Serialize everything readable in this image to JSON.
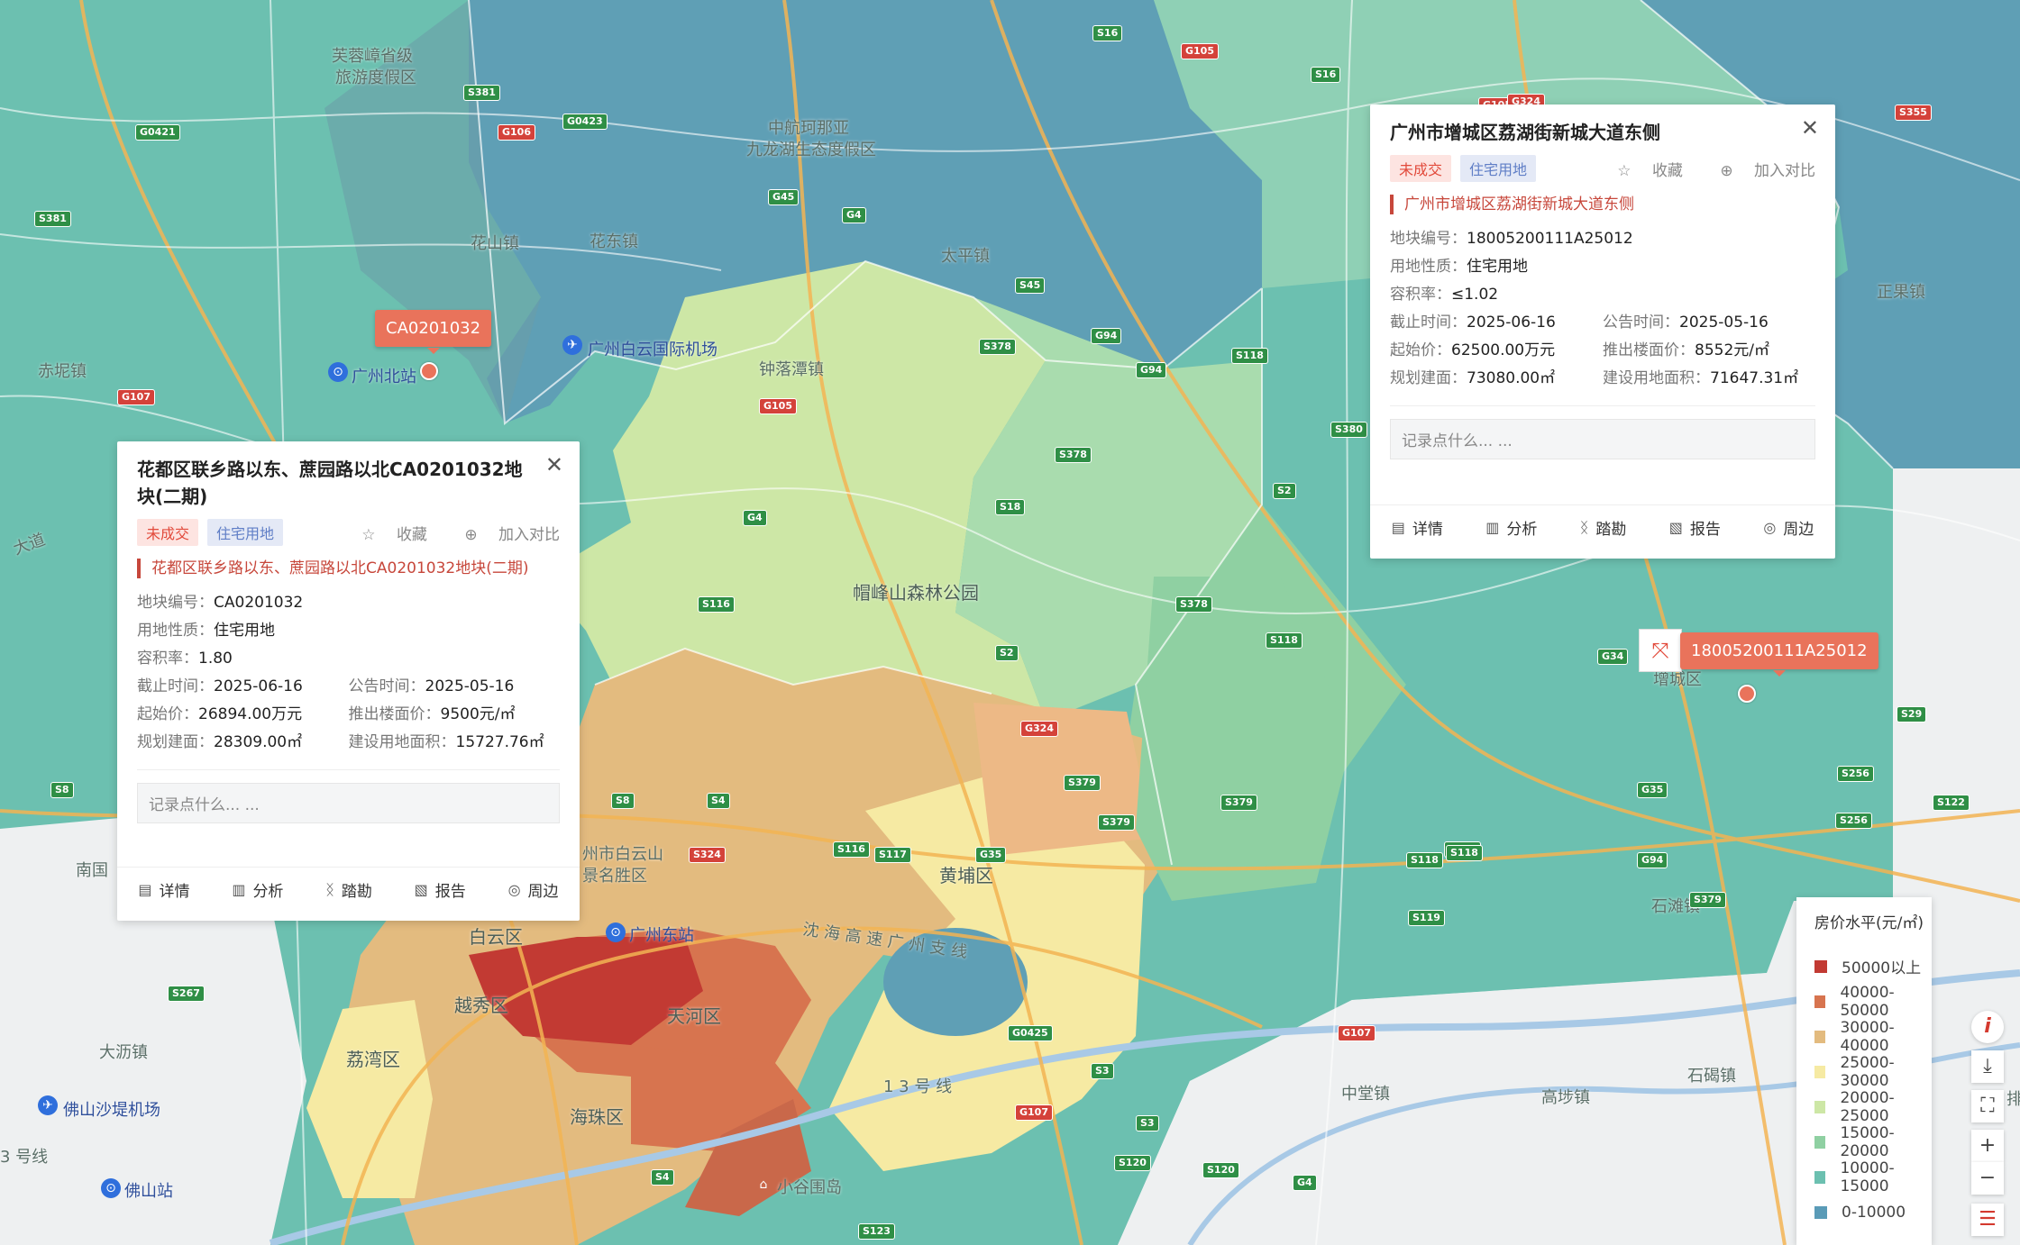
{
  "map": {
    "place_labels": [
      {
        "text": "芙蓉嶂省级",
        "name": "place-furongzhang"
      },
      {
        "text": "旅游度假区",
        "name": "place-resort"
      },
      {
        "text": "中航珂那亚",
        "name": "place-zhonghang"
      },
      {
        "text": "九龙湖生态度假区",
        "name": "place-jiulonghu"
      },
      {
        "text": "花山镇",
        "name": "place-huashan"
      },
      {
        "text": "花东镇",
        "name": "place-huadong"
      },
      {
        "text": "太平镇",
        "name": "place-taiping"
      },
      {
        "text": "钟落潭镇",
        "name": "place-zhongluotan"
      },
      {
        "text": "赤坭镇",
        "name": "place-chini"
      },
      {
        "text": "帽峰山森林公园",
        "name": "place-maofengshan"
      },
      {
        "text": "正果镇",
        "name": "place-zhengguo"
      },
      {
        "text": "黄埔区",
        "name": "place-huangpu"
      },
      {
        "text": "白云区",
        "name": "place-baiyun"
      },
      {
        "text": "越秀区",
        "name": "place-yuexiu"
      },
      {
        "text": "天河区",
        "name": "place-tianhe"
      },
      {
        "text": "荔湾区",
        "name": "place-liwan"
      },
      {
        "text": "海珠区",
        "name": "place-haizhu"
      },
      {
        "text": "大沥镇",
        "name": "place-dali"
      },
      {
        "text": "南国",
        "name": "place-nanguo"
      },
      {
        "text": "中堂镇",
        "name": "place-zhongtang"
      },
      {
        "text": "高埗镇",
        "name": "place-gaobu"
      },
      {
        "text": "石碣镇",
        "name": "place-shijie"
      },
      {
        "text": "石滩镇",
        "name": "place-shitan"
      },
      {
        "text": "1 3 号 线",
        "name": "place-line13"
      },
      {
        "text": "沈 海 高 速 广 州 支 线",
        "name": "place-shenhai"
      },
      {
        "text": "州市白云山",
        "name": "place-baiyunshan1"
      },
      {
        "text": "景名胜区",
        "name": "place-baiyunshan2"
      },
      {
        "text": "增城区",
        "name": "place-zengcheng"
      },
      {
        "text": "大道",
        "name": "place-dadao"
      },
      {
        "text": "排",
        "name": "place-pai"
      },
      {
        "text": "3 号线",
        "name": "place-line3"
      }
    ],
    "poi_labels": [
      {
        "text": "广州白云国际机场",
        "name": "poi-baiyun-airport"
      },
      {
        "text": "广州北站",
        "name": "poi-guangzhou-north"
      },
      {
        "text": "广州东站",
        "name": "poi-guangzhou-east"
      },
      {
        "text": "佛山沙堤机场",
        "name": "poi-shadi-airport"
      },
      {
        "text": "佛山站",
        "name": "poi-foshan-station"
      },
      {
        "text": "小谷围岛",
        "name": "poi-xiaoguwei"
      }
    ],
    "shields": [
      {
        "text": "S381",
        "t": "s"
      },
      {
        "text": "G106",
        "t": "g"
      },
      {
        "text": "G0423",
        "t": "s"
      },
      {
        "text": "G0421",
        "t": "s"
      },
      {
        "text": "S381",
        "t": "s"
      },
      {
        "text": "G45",
        "t": "s"
      },
      {
        "text": "G4",
        "t": "s"
      },
      {
        "text": "S16",
        "t": "s"
      },
      {
        "text": "G105",
        "t": "g"
      },
      {
        "text": "S16",
        "t": "s"
      },
      {
        "text": "S45",
        "t": "s"
      },
      {
        "text": "G105",
        "t": "g"
      },
      {
        "text": "G94",
        "t": "s"
      },
      {
        "text": "S378",
        "t": "s"
      },
      {
        "text": "G94",
        "t": "s"
      },
      {
        "text": "S118",
        "t": "s"
      },
      {
        "text": "G107",
        "t": "g"
      },
      {
        "text": "G105",
        "t": "g"
      },
      {
        "text": "S378",
        "t": "s"
      },
      {
        "text": "S380",
        "t": "s"
      },
      {
        "text": "S2",
        "t": "s"
      },
      {
        "text": "G4",
        "t": "s"
      },
      {
        "text": "S18",
        "t": "s"
      },
      {
        "text": "S116",
        "t": "s"
      },
      {
        "text": "S378",
        "t": "s"
      },
      {
        "text": "S118",
        "t": "s"
      },
      {
        "text": "S2",
        "t": "s"
      },
      {
        "text": "G324",
        "t": "g"
      },
      {
        "text": "S379",
        "t": "s"
      },
      {
        "text": "S379",
        "t": "s"
      },
      {
        "text": "S8",
        "t": "s"
      },
      {
        "text": "S4",
        "t": "s"
      },
      {
        "text": "S116",
        "t": "s"
      },
      {
        "text": "S117",
        "t": "s"
      },
      {
        "text": "G35",
        "t": "s"
      },
      {
        "text": "S379",
        "t": "s"
      },
      {
        "text": "S118",
        "t": "s"
      },
      {
        "text": "S118",
        "t": "s"
      },
      {
        "text": "S379",
        "t": "s"
      },
      {
        "text": "G94",
        "t": "s"
      },
      {
        "text": "G0425",
        "t": "s"
      },
      {
        "text": "S3",
        "t": "s"
      },
      {
        "text": "G107",
        "t": "g"
      },
      {
        "text": "S3",
        "t": "s"
      },
      {
        "text": "S120",
        "t": "s"
      },
      {
        "text": "S120",
        "t": "s"
      },
      {
        "text": "G4",
        "t": "s"
      },
      {
        "text": "S4",
        "t": "s"
      },
      {
        "text": "S123",
        "t": "s"
      },
      {
        "text": "S267",
        "t": "s"
      },
      {
        "text": "S8",
        "t": "s"
      },
      {
        "text": "G34",
        "t": "s"
      },
      {
        "text": "S29",
        "t": "s"
      },
      {
        "text": "S256",
        "t": "s"
      },
      {
        "text": "S256",
        "t": "s"
      },
      {
        "text": "S122",
        "t": "s"
      },
      {
        "text": "G35",
        "t": "s"
      },
      {
        "text": "S118",
        "t": "s"
      },
      {
        "text": "G107",
        "t": "g"
      },
      {
        "text": "S119",
        "t": "s"
      },
      {
        "text": "G324",
        "t": "g"
      },
      {
        "text": "S324",
        "t": "g"
      },
      {
        "text": "S355",
        "t": "g"
      }
    ]
  },
  "markers": {
    "left": {
      "label": "CA0201032"
    },
    "right": {
      "label": "18005200111A25012"
    }
  },
  "card_left": {
    "title": "花都区联乡路以东、蔗园路以北CA0201032地块(二期)",
    "status_tag": "未成交",
    "type_tag": "住宅用地",
    "favorite": "收藏",
    "compare": "加入对比",
    "subhead": "花都区联乡路以东、蔗园路以北CA0201032地块(二期)",
    "plot_no_k": "地块编号：",
    "plot_no_v": "CA0201032",
    "use_k": "用地性质：",
    "use_v": "住宅用地",
    "far_k": "容积率：",
    "far_v": "1.80",
    "deadline_k": "截止时间：",
    "deadline_v": "2025-06-16",
    "notice_k": "公告时间：",
    "notice_v": "2025-05-16",
    "start_price_k": "起始价：",
    "start_price_v": "26894.00万元",
    "floor_price_k": "推出楼面价：",
    "floor_price_v": "9500元/㎡",
    "plan_area_k": "规划建面：",
    "plan_area_v": "28309.00㎡",
    "land_area_k": "建设用地面积：",
    "land_area_v": "15727.76㎡",
    "note_placeholder": "记录点什么... ...",
    "foot": [
      "详情",
      "分析",
      "踏勘",
      "报告",
      "周边"
    ]
  },
  "card_right": {
    "title": "广州市增城区荔湖街新城大道东侧",
    "status_tag": "未成交",
    "type_tag": "住宅用地",
    "favorite": "收藏",
    "compare": "加入对比",
    "subhead": "广州市增城区荔湖街新城大道东侧",
    "plot_no_k": "地块编号：",
    "plot_no_v": "18005200111A25012",
    "use_k": "用地性质：",
    "use_v": "住宅用地",
    "far_k": "容积率：",
    "far_v": "≤1.02",
    "deadline_k": "截止时间：",
    "deadline_v": "2025-06-16",
    "notice_k": "公告时间：",
    "notice_v": "2025-05-16",
    "start_price_k": "起始价：",
    "start_price_v": "62500.00万元",
    "floor_price_k": "推出楼面价：",
    "floor_price_v": "8552元/㎡",
    "plan_area_k": "规划建面：",
    "plan_area_v": "73080.00㎡",
    "land_area_k": "建设用地面积：",
    "land_area_v": "71647.31㎡",
    "note_placeholder": "记录点什么... ...",
    "foot": [
      "详情",
      "分析",
      "踏勘",
      "报告",
      "周边"
    ]
  },
  "legend": {
    "title": "房价水平(元/㎡)",
    "items": [
      {
        "label": "50000以上",
        "color": "#c23a33"
      },
      {
        "label": "40000-50000",
        "color": "#d7744f"
      },
      {
        "label": "30000-40000",
        "color": "#e3bb7f"
      },
      {
        "label": "25000-30000",
        "color": "#f6eaa3"
      },
      {
        "label": "20000-25000",
        "color": "#cde7a6"
      },
      {
        "label": "15000-20000",
        "color": "#8fd0a2"
      },
      {
        "label": "10000-15000",
        "color": "#6cc0b0"
      },
      {
        "label": "0-10000",
        "color": "#5a9bb7"
      }
    ]
  },
  "toolbar": {
    "info": "i",
    "download": "⤓",
    "fullscreen": "⛶",
    "zoom_in": "+",
    "zoom_out": "−",
    "list": "☰"
  }
}
